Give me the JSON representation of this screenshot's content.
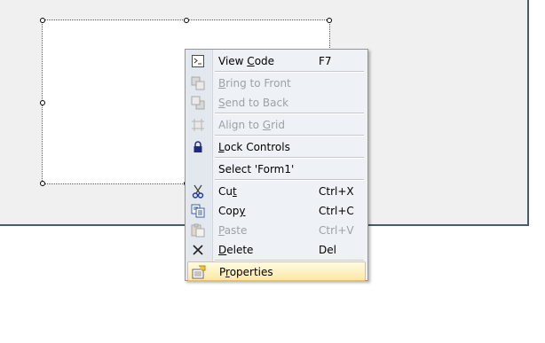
{
  "menu": {
    "view_code": {
      "pre": "View ",
      "ul": "C",
      "post": "ode",
      "shortcut": "F7",
      "icon": "code-icon"
    },
    "bring_to_front": {
      "pre": "",
      "ul": "B",
      "post": "ring to Front",
      "icon": "bring-to-front-icon"
    },
    "send_to_back": {
      "pre": "",
      "ul": "S",
      "post": "end to Back",
      "icon": "send-to-back-icon"
    },
    "align_to_grid": {
      "pre": "Align to ",
      "ul": "G",
      "post": "rid",
      "icon": "align-grid-icon"
    },
    "lock_controls": {
      "pre": "",
      "ul": "L",
      "post": "ock Controls",
      "icon": "lock-icon"
    },
    "select_form": {
      "label": "Select 'Form1'"
    },
    "cut": {
      "pre": "Cu",
      "ul": "t",
      "post": "",
      "shortcut": "Ctrl+X",
      "icon": "scissors-icon"
    },
    "copy": {
      "pre": "Cop",
      "ul": "y",
      "post": "",
      "shortcut": "Ctrl+C",
      "icon": "copy-icon"
    },
    "paste": {
      "pre": "",
      "ul": "P",
      "post": "aste",
      "shortcut": "Ctrl+V",
      "icon": "paste-icon"
    },
    "delete": {
      "pre": "",
      "ul": "D",
      "post": "elete",
      "shortcut": "Del",
      "icon": "delete-icon"
    },
    "properties": {
      "pre": "P",
      "ul": "r",
      "post": "operties",
      "icon": "properties-icon"
    }
  },
  "colors": {
    "highlight_border": "#e5c365",
    "disabled_text": "#9da2a8",
    "menu_background": "#eef1f5"
  }
}
